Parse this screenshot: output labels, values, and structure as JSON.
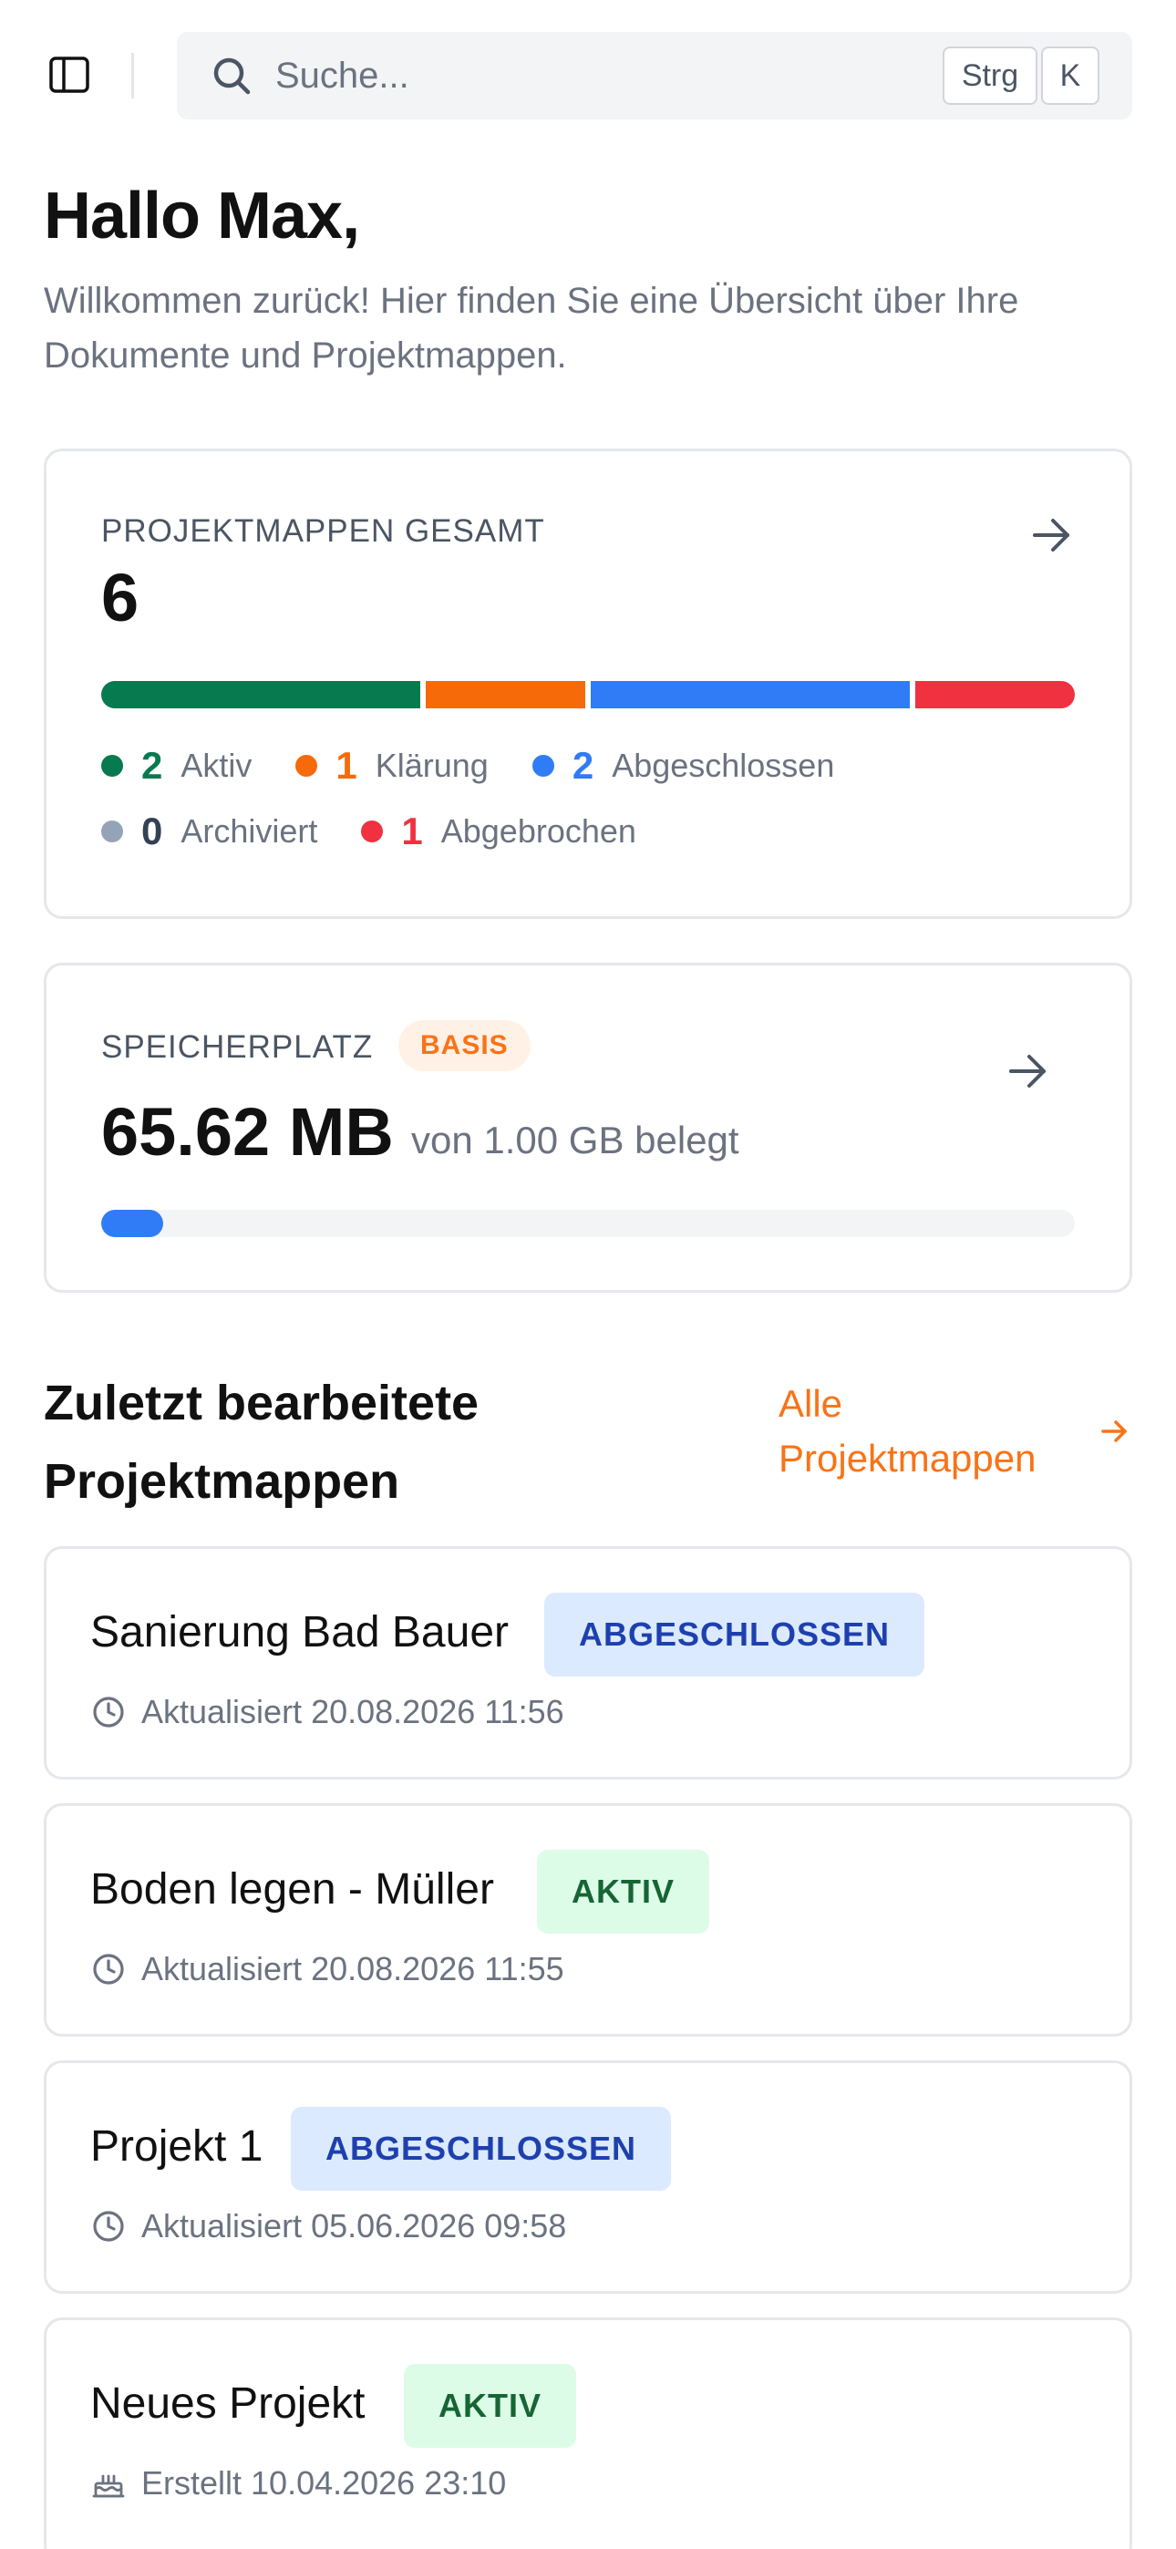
{
  "topbar": {
    "search_placeholder": "Suche...",
    "shortcut_modifier": "Strg",
    "shortcut_key": "K"
  },
  "greeting": {
    "title": "Hallo Max,",
    "subtitle": "Willkommen zurück! Hier finden Sie eine Übersicht über Ihre Dokumente und Projektmappen."
  },
  "projects_card": {
    "label": "PROJEKTMAPPEN GESAMT",
    "total": "6",
    "segments": [
      {
        "status": "Aktiv",
        "count": 2,
        "color": "#087a4f"
      },
      {
        "status": "Klärung",
        "count": 1,
        "color": "#f66a0a"
      },
      {
        "status": "Abgeschlossen",
        "count": 2,
        "color": "#2f7cf6"
      },
      {
        "status": "Abgebrochen",
        "count": 1,
        "color": "#f0313f"
      }
    ],
    "legend": [
      {
        "count": "2",
        "label": "Aktiv",
        "color": "#087a4f"
      },
      {
        "count": "1",
        "label": "Klärung",
        "color": "#f66a0a"
      },
      {
        "count": "2",
        "label": "Abgeschlossen",
        "color": "#2f7cf6"
      },
      {
        "count": "0",
        "label": "Archiviert",
        "color": "#94a3b8"
      },
      {
        "count": "1",
        "label": "Abgebrochen",
        "color": "#f0313f"
      }
    ]
  },
  "storage_card": {
    "label": "SPEICHERPLATZ",
    "plan_badge": "BASIS",
    "used": "65.62 MB",
    "of_total": "von 1.00 GB belegt",
    "used_fraction": 0.064
  },
  "recent": {
    "title": "Zuletzt bearbeitete Projektmappen",
    "all_link": "Alle Projektmappen",
    "items": [
      {
        "title": "Sanierung Bad Bauer",
        "status": "ABGESCHLOSSEN",
        "meta": "Aktualisiert 20.08.2026 11:56"
      },
      {
        "title": "Boden legen - Müller",
        "status": "AKTIV",
        "meta": "Aktualisiert 20.08.2026 11:55"
      },
      {
        "title": "Projekt 1",
        "status": "ABGESCHLOSSEN",
        "meta": "Aktualisiert 05.06.2026 09:58"
      },
      {
        "title": "Neues Projekt",
        "status": "AKTIV",
        "meta": "Erstellt 10.04.2026 23:10"
      }
    ]
  }
}
